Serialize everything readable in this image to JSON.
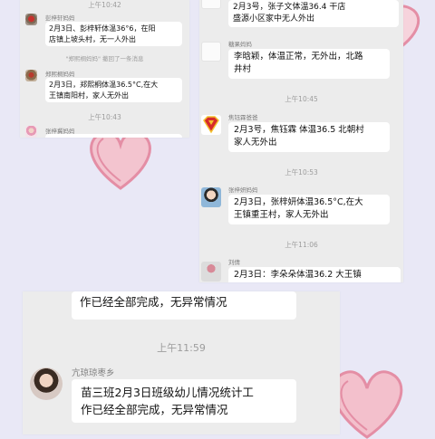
{
  "panel_left": {
    "time_top": "上午10:42",
    "messages": [
      {
        "name": "彭梓轩妈妈",
        "lines": [
          "2月3日、彭梓轩体温36°6，在阳",
          "店镇上坡头村，无一人外出"
        ]
      },
      {
        "name": "郑熙桐妈妈",
        "lines": [
          "2月3日，郑熙桐体温36.5°C,在大",
          "王镇南阳村，家人无外出"
        ]
      }
    ],
    "recall_notice": "\"郑熙桐妈妈\" 撤回了一条消息",
    "time_bottom": "上午10:43",
    "last_name": "张梓冀妈妈"
  },
  "panel_right": {
    "top_lines": [
      "2月3号，张子文体温36.4    干店",
      "盛源小区家中无人外出"
    ],
    "messages": [
      {
        "name": "糖果妈妈",
        "lines": [
          "李晗颖，体温正常，无外出，北路",
          "井村"
        ]
      },
      {
        "name": "焦钰霖爸爸",
        "lines": [
          "2月3号，焦钰霖 体温36.5 北朝村",
          "家人无外出"
        ]
      },
      {
        "name": "张梓妍妈妈",
        "lines": [
          "2月3日，张梓妍体温36.5°C,在大",
          "王镇重王村，家人无外出"
        ]
      },
      {
        "name": "刘倩",
        "lines": [
          "2月3日：李朵朵体温36.2  大王镇"
        ]
      }
    ],
    "times": [
      "上午10:45",
      "上午10:53",
      "上午11:06"
    ]
  },
  "panel_bottom": {
    "top_line": "作已经全部完成，无异常情况",
    "time": "上午11:59",
    "name": "亢琼琼枣乡",
    "lines": [
      "苗三班2月3日班级幼儿情况统计工",
      "作已经全部完成，无异常情况"
    ]
  },
  "colors": {
    "background": "#e9e8f6",
    "panel": "#ececec",
    "bubble": "#ffffff",
    "heart": "#e8a4b4"
  }
}
